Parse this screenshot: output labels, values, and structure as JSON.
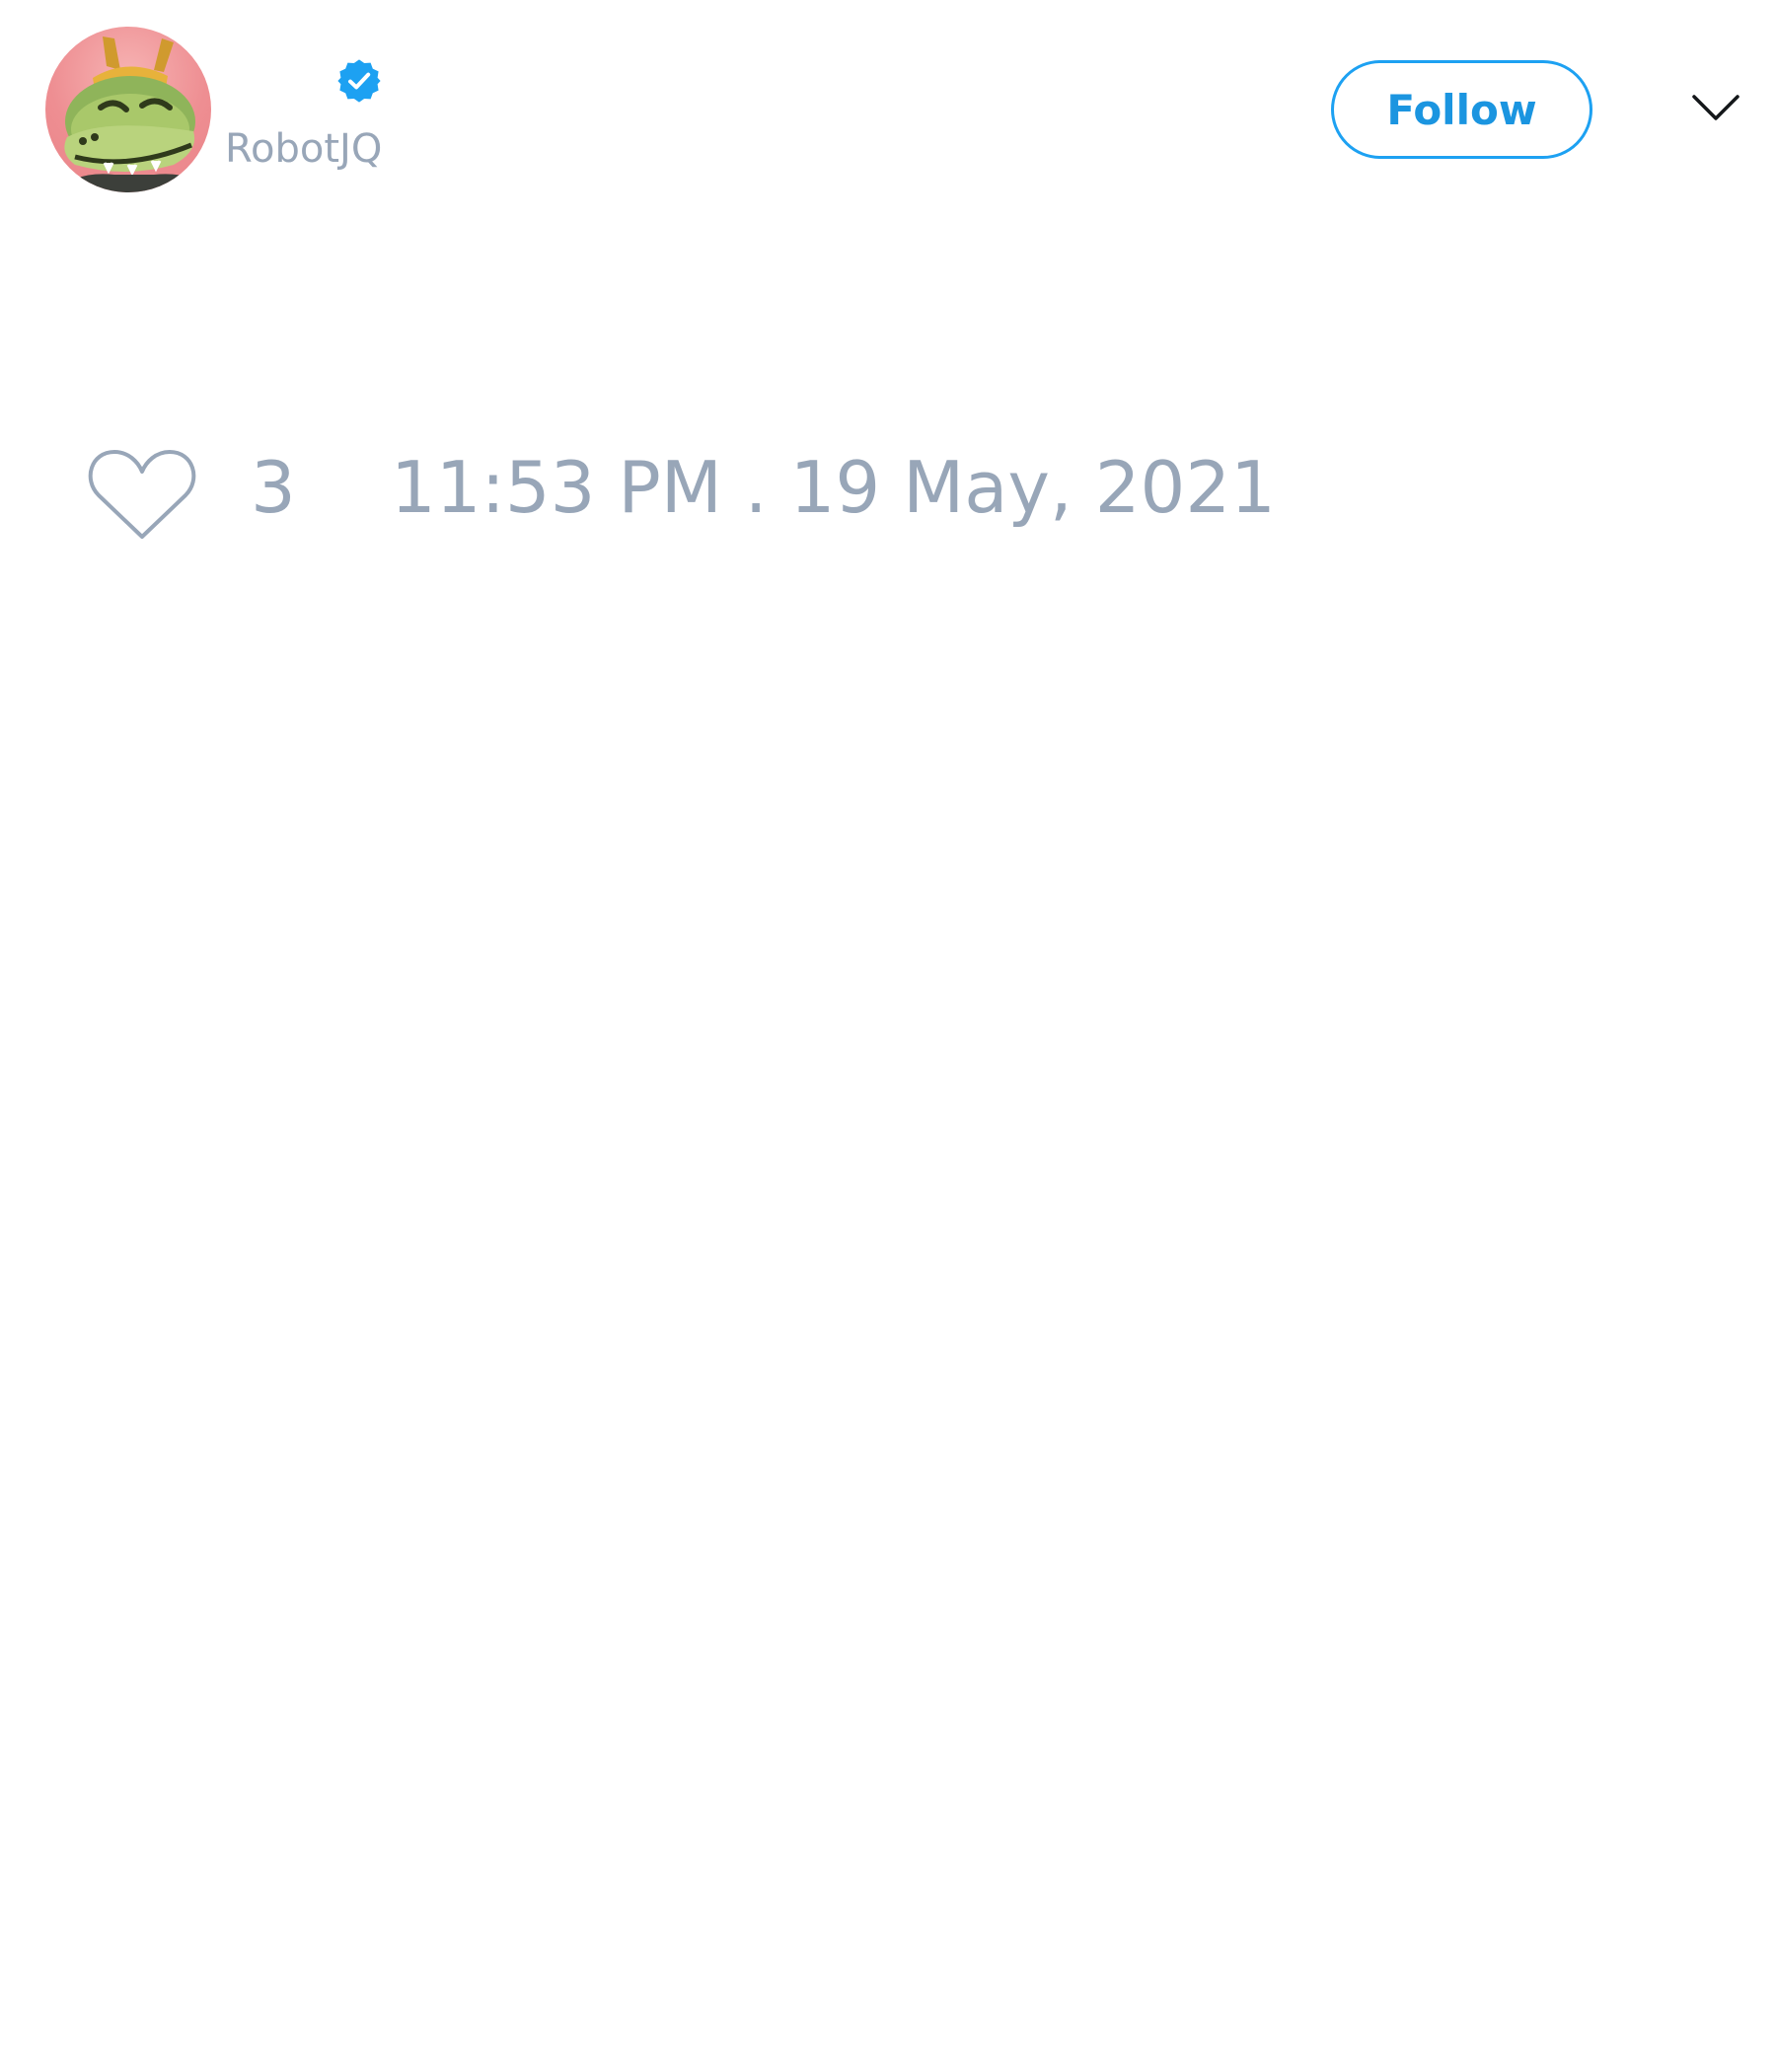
{
  "tweet": {
    "author": {
      "handle": "RobotJQ",
      "verified": true,
      "avatar_icon": "crocodile-avatar-icon"
    },
    "follow_label": "Follow",
    "menu_icon": "chevron-down-icon",
    "likes": {
      "icon": "heart-outline-icon",
      "count": "3"
    },
    "timestamp": "11:53 PM . 19 May, 2021"
  },
  "colors": {
    "accent": "#1da1f2",
    "muted_text": "#98a6b8",
    "background": "#ffffff"
  }
}
